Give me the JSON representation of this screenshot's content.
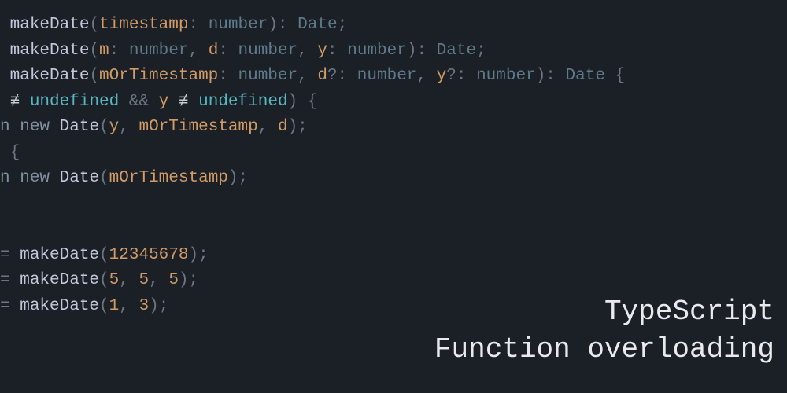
{
  "title": {
    "line1": "TypeScript",
    "line2": "Function overloading"
  },
  "code": {
    "tokens": [
      [
        {
          "t": " ",
          "c": "c-punct"
        },
        {
          "t": "makeDate",
          "c": "c-fn"
        },
        {
          "t": "(",
          "c": "c-punct"
        },
        {
          "t": "timestamp",
          "c": "c-param"
        },
        {
          "t": ":",
          "c": "c-punct"
        },
        {
          "t": " ",
          "c": ""
        },
        {
          "t": "number",
          "c": "c-type"
        },
        {
          "t": ")",
          "c": "c-punct"
        },
        {
          "t": ":",
          "c": "c-punct"
        },
        {
          "t": " ",
          "c": ""
        },
        {
          "t": "Date",
          "c": "c-type"
        },
        {
          "t": ";",
          "c": "c-punct"
        }
      ],
      [
        {
          "t": " ",
          "c": "c-punct"
        },
        {
          "t": "makeDate",
          "c": "c-fn"
        },
        {
          "t": "(",
          "c": "c-punct"
        },
        {
          "t": "m",
          "c": "c-param"
        },
        {
          "t": ":",
          "c": "c-punct"
        },
        {
          "t": " ",
          "c": ""
        },
        {
          "t": "number",
          "c": "c-type"
        },
        {
          "t": ",",
          "c": "c-punct"
        },
        {
          "t": " ",
          "c": ""
        },
        {
          "t": "d",
          "c": "c-param"
        },
        {
          "t": ":",
          "c": "c-punct"
        },
        {
          "t": " ",
          "c": ""
        },
        {
          "t": "number",
          "c": "c-type"
        },
        {
          "t": ",",
          "c": "c-punct"
        },
        {
          "t": " ",
          "c": ""
        },
        {
          "t": "y",
          "c": "c-param"
        },
        {
          "t": ":",
          "c": "c-punct"
        },
        {
          "t": " ",
          "c": ""
        },
        {
          "t": "number",
          "c": "c-type"
        },
        {
          "t": ")",
          "c": "c-punct"
        },
        {
          "t": ":",
          "c": "c-punct"
        },
        {
          "t": " ",
          "c": ""
        },
        {
          "t": "Date",
          "c": "c-type"
        },
        {
          "t": ";",
          "c": "c-punct"
        }
      ],
      [
        {
          "t": " ",
          "c": "c-punct"
        },
        {
          "t": "makeDate",
          "c": "c-fn"
        },
        {
          "t": "(",
          "c": "c-punct"
        },
        {
          "t": "mOrTimestamp",
          "c": "c-param"
        },
        {
          "t": ":",
          "c": "c-punct"
        },
        {
          "t": " ",
          "c": ""
        },
        {
          "t": "number",
          "c": "c-type"
        },
        {
          "t": ",",
          "c": "c-punct"
        },
        {
          "t": " ",
          "c": ""
        },
        {
          "t": "d",
          "c": "c-param"
        },
        {
          "t": "?:",
          "c": "c-punct"
        },
        {
          "t": " ",
          "c": ""
        },
        {
          "t": "number",
          "c": "c-type"
        },
        {
          "t": ",",
          "c": "c-punct"
        },
        {
          "t": " ",
          "c": ""
        },
        {
          "t": "y",
          "c": "c-param"
        },
        {
          "t": "?:",
          "c": "c-punct"
        },
        {
          "t": " ",
          "c": ""
        },
        {
          "t": "number",
          "c": "c-type"
        },
        {
          "t": ")",
          "c": "c-punct"
        },
        {
          "t": ":",
          "c": "c-punct"
        },
        {
          "t": " ",
          "c": ""
        },
        {
          "t": "Date",
          "c": "c-type"
        },
        {
          "t": " {",
          "c": "c-punct"
        }
      ],
      [
        {
          "t": " ",
          "c": ""
        },
        {
          "t": "≢",
          "c": "c-op"
        },
        {
          "t": " ",
          "c": ""
        },
        {
          "t": "undefined",
          "c": "c-undef"
        },
        {
          "t": " ",
          "c": ""
        },
        {
          "t": "&&",
          "c": "c-punct"
        },
        {
          "t": " ",
          "c": ""
        },
        {
          "t": "y",
          "c": "c-param"
        },
        {
          "t": " ",
          "c": ""
        },
        {
          "t": "≢",
          "c": "c-op"
        },
        {
          "t": " ",
          "c": ""
        },
        {
          "t": "undefined",
          "c": "c-undef"
        },
        {
          "t": ")",
          "c": "c-punct"
        },
        {
          "t": " {",
          "c": "c-punct"
        }
      ],
      [
        {
          "t": "n ",
          "c": "c-kw"
        },
        {
          "t": "new",
          "c": "c-kw"
        },
        {
          "t": " ",
          "c": ""
        },
        {
          "t": "Date",
          "c": "c-fn"
        },
        {
          "t": "(",
          "c": "c-punct"
        },
        {
          "t": "y",
          "c": "c-param"
        },
        {
          "t": ",",
          "c": "c-punct"
        },
        {
          "t": " ",
          "c": ""
        },
        {
          "t": "mOrTimestamp",
          "c": "c-param"
        },
        {
          "t": ",",
          "c": "c-punct"
        },
        {
          "t": " ",
          "c": ""
        },
        {
          "t": "d",
          "c": "c-param"
        },
        {
          "t": ")",
          "c": "c-punct"
        },
        {
          "t": ";",
          "c": "c-punct"
        }
      ],
      [
        {
          "t": " {",
          "c": "c-punct"
        }
      ],
      [
        {
          "t": "n ",
          "c": "c-kw"
        },
        {
          "t": "new",
          "c": "c-kw"
        },
        {
          "t": " ",
          "c": ""
        },
        {
          "t": "Date",
          "c": "c-fn"
        },
        {
          "t": "(",
          "c": "c-punct"
        },
        {
          "t": "mOrTimestamp",
          "c": "c-param"
        },
        {
          "t": ")",
          "c": "c-punct"
        },
        {
          "t": ";",
          "c": "c-punct"
        }
      ],
      [
        {
          "t": " ",
          "c": ""
        }
      ],
      [
        {
          "t": " ",
          "c": ""
        }
      ],
      [
        {
          "t": "= ",
          "c": "c-punct"
        },
        {
          "t": "makeDate",
          "c": "c-fn"
        },
        {
          "t": "(",
          "c": "c-punct"
        },
        {
          "t": "12345678",
          "c": "c-num"
        },
        {
          "t": ")",
          "c": "c-punct"
        },
        {
          "t": ";",
          "c": "c-punct"
        }
      ],
      [
        {
          "t": "= ",
          "c": "c-punct"
        },
        {
          "t": "makeDate",
          "c": "c-fn"
        },
        {
          "t": "(",
          "c": "c-punct"
        },
        {
          "t": "5",
          "c": "c-num"
        },
        {
          "t": ",",
          "c": "c-punct"
        },
        {
          "t": " ",
          "c": ""
        },
        {
          "t": "5",
          "c": "c-num"
        },
        {
          "t": ",",
          "c": "c-punct"
        },
        {
          "t": " ",
          "c": ""
        },
        {
          "t": "5",
          "c": "c-num"
        },
        {
          "t": ")",
          "c": "c-punct"
        },
        {
          "t": ";",
          "c": "c-punct"
        }
      ],
      [
        {
          "t": "= ",
          "c": "c-punct"
        },
        {
          "t": "makeDate",
          "c": "c-fn"
        },
        {
          "t": "(",
          "c": "c-punct"
        },
        {
          "t": "1",
          "c": "c-num"
        },
        {
          "t": ",",
          "c": "c-punct"
        },
        {
          "t": " ",
          "c": ""
        },
        {
          "t": "3",
          "c": "c-num"
        },
        {
          "t": ")",
          "c": "c-punct"
        },
        {
          "t": ";",
          "c": "c-punct"
        }
      ]
    ]
  }
}
